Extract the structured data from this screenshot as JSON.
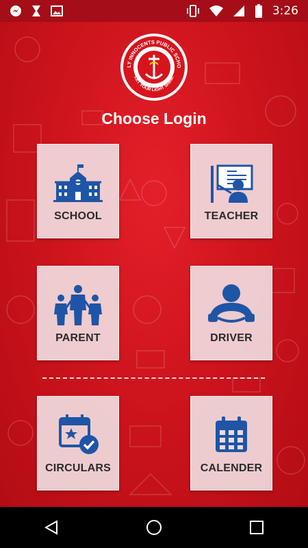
{
  "status_bar": {
    "time": "3:26",
    "left_icons": [
      "messenger-icon",
      "hourglass-icon",
      "image-icon"
    ],
    "right_icons": [
      "vibrate-icon",
      "wifi-icon",
      "signal-icon",
      "battery-icon"
    ]
  },
  "logo": {
    "name": "HOLY INNOCENTS PUBLIC SCHOOL",
    "motto": "LET YOUR LIGHT SHINE"
  },
  "title": "Choose Login",
  "tiles": [
    {
      "label": "SCHOOL",
      "icon": "school-building-icon"
    },
    {
      "label": "TEACHER",
      "icon": "teacher-board-icon"
    },
    {
      "label": "PARENT",
      "icon": "family-icon"
    },
    {
      "label": "DRIVER",
      "icon": "driver-steering-icon"
    },
    {
      "label": "CIRCULARS",
      "icon": "calendar-star-check-icon"
    },
    {
      "label": "CALENDER",
      "icon": "calendar-icon"
    }
  ],
  "navigation": [
    "back-icon",
    "home-icon",
    "recents-icon"
  ],
  "colors": {
    "primary_red": "#cf141d",
    "icon_blue": "#1f55a6",
    "tile_bg": "#f0dade"
  }
}
